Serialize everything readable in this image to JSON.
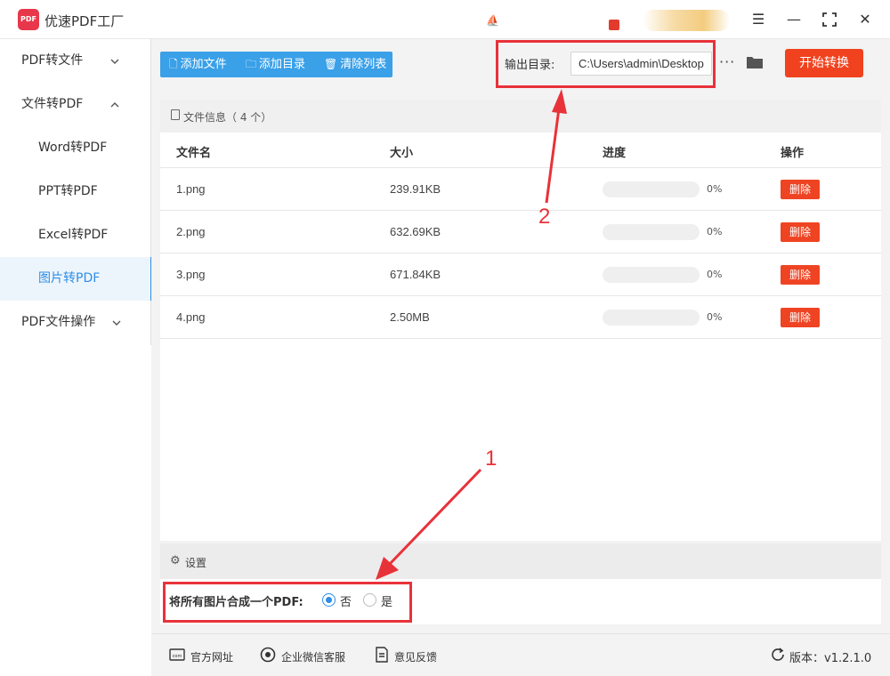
{
  "titlebar": {
    "app_title": "优速PDF工厂",
    "logo_text": "PDF",
    "menu_icon": "menu-icon",
    "minimize_icon": "minimize-icon",
    "maximize_icon": "maximize-icon",
    "close_icon": "close-icon"
  },
  "sidebar": {
    "items": [
      {
        "label": "PDF转文件",
        "chevron": "⌄"
      },
      {
        "label": "文件转PDF",
        "chevron": "⌃"
      },
      {
        "label": "Word转PDF"
      },
      {
        "label": "PPT转PDF"
      },
      {
        "label": "Excel转PDF"
      },
      {
        "label": "图片转PDF",
        "active": true
      },
      {
        "label": "PDF文件操作",
        "chevron": "⌄"
      }
    ]
  },
  "toolbar": {
    "add_file": "添加文件",
    "add_dir": "添加目录",
    "clear_list": "清除列表",
    "output_label": "输出目录:",
    "output_value": "C:\\Users\\admin\\Desktop",
    "more": "···",
    "start": "开始转换"
  },
  "file_panel": {
    "header": "文件信息（ 4 个）",
    "columns": [
      "文件名",
      "大小",
      "进度",
      "操作"
    ],
    "rows": [
      {
        "name": "1.png",
        "size": "239.91KB",
        "progress": "0%",
        "action": "删除"
      },
      {
        "name": "2.png",
        "size": "632.69KB",
        "progress": "0%",
        "action": "删除"
      },
      {
        "name": "3.png",
        "size": "671.84KB",
        "progress": "0%",
        "action": "删除"
      },
      {
        "name": "4.png",
        "size": "2.50MB",
        "progress": "0%",
        "action": "删除"
      }
    ]
  },
  "settings": {
    "header": "设置",
    "merge_label": "将所有图片合成一个PDF:",
    "option_no": "否",
    "option_yes": "是",
    "selected": "否"
  },
  "footer": {
    "website": "官方网址",
    "wechat": "企业微信客服",
    "feedback": "意见反馈",
    "version": "版本：v1.2.1.0"
  },
  "annotations": {
    "label_1": "1",
    "label_2": "2",
    "color": "#e8323a"
  },
  "colors": {
    "accent_blue": "#3aa0e8",
    "start_orange": "#f0421e",
    "delete_red": "#ef4423",
    "active_blue": "#2e8de6"
  }
}
